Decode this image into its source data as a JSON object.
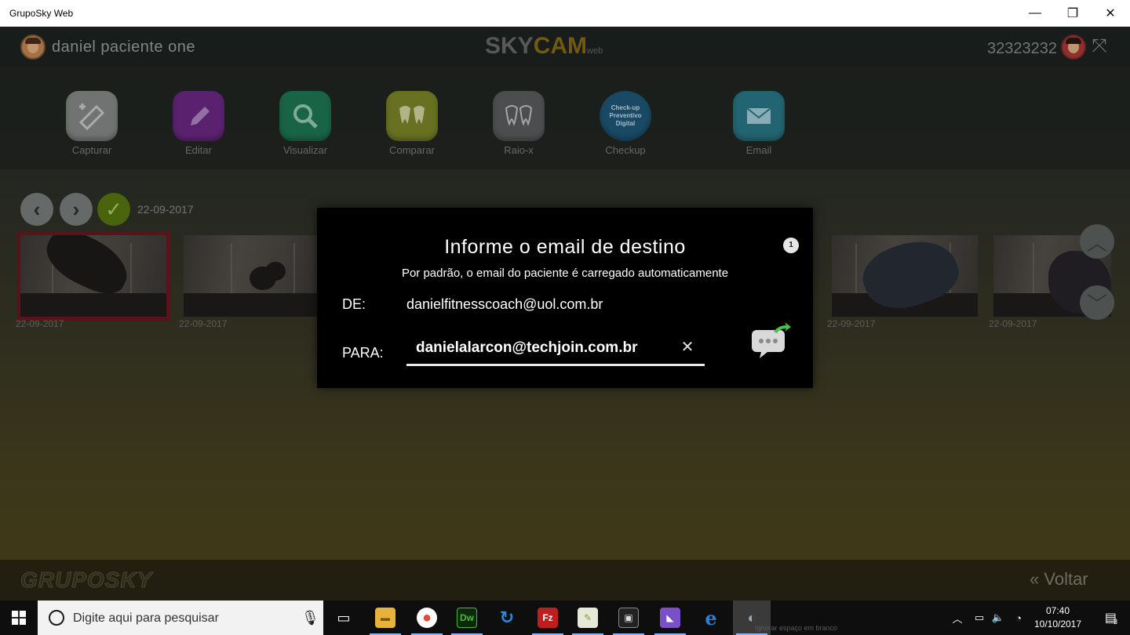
{
  "window": {
    "title": "GrupoSky Web",
    "controls": {
      "minimize": "—",
      "restore": "❐",
      "close": "✕"
    }
  },
  "header": {
    "patient_name": "daniel paciente one",
    "brand_sky": "SKY",
    "brand_cam": "CAM",
    "brand_web": "web",
    "patient_id": "32323232",
    "expand_glyph": "⤧"
  },
  "toolbar": {
    "items": [
      {
        "label": "Capturar",
        "icon": "camera-capture-icon",
        "color": "#8a8d8c"
      },
      {
        "label": "Editar",
        "icon": "pencil-icon",
        "color": "#6e2a87"
      },
      {
        "label": "Visualizar",
        "icon": "magnifier-icon",
        "color": "#1f7a57"
      },
      {
        "label": "Comparar",
        "icon": "teeth-icon",
        "color": "#7f8a2a"
      },
      {
        "label": "Raio-x",
        "icon": "xray-teeth-icon",
        "color": "#5d5f60"
      },
      {
        "label": "Checkup",
        "icon": "checkup-badge-icon",
        "color": "#1f5a7a",
        "badge_text": "Check-up Preventivo Digital"
      },
      {
        "label": "Email",
        "icon": "envelope-icon",
        "color": "#2a7a8a"
      }
    ]
  },
  "nav": {
    "prev_glyph": "‹",
    "next_glyph": "›",
    "check_glyph": "✓",
    "date": "22-09-2017"
  },
  "thumbnails": [
    {
      "date": "22-09-2017",
      "selected": true
    },
    {
      "date": "22-09-2017",
      "selected": false
    },
    {
      "date": "22-09-2017",
      "selected": false
    },
    {
      "date": "22-09-2017",
      "selected": false
    }
  ],
  "scroll": {
    "up_glyph": "︿",
    "down_glyph": "﹀"
  },
  "footer": {
    "logo": "GRUPOSKY",
    "back_label": "Voltar",
    "back_glyph": "«"
  },
  "modal": {
    "title": "Informe o email de destino",
    "subtitle": "Por padrão, o email do paciente é carregado automaticamente",
    "info_badge": "1",
    "from_label": "DE:",
    "from_value": "danielfitnesscoach@uol.com.br",
    "to_label": "PARA:",
    "to_value": "danielalarcon@techjoin.com.br",
    "clear_glyph": "✕"
  },
  "taskbar": {
    "search_placeholder": "Digite aqui para pesquisar",
    "apps": [
      {
        "name": "task-view",
        "glyph": "▭"
      },
      {
        "name": "file-explorer",
        "glyph": "▬",
        "color": "#e8b33a"
      },
      {
        "name": "chrome",
        "glyph": "●",
        "color": "#dd4b39"
      },
      {
        "name": "dreamweaver",
        "glyph": "Dw",
        "color": "#4cb83a"
      },
      {
        "name": "refresh-app",
        "glyph": "↻",
        "color": "#2a8ae0"
      },
      {
        "name": "filezilla",
        "glyph": "Fz",
        "color": "#bf1e1e"
      },
      {
        "name": "notepad",
        "glyph": "✎",
        "color": "#7aa640"
      },
      {
        "name": "terminal",
        "glyph": "▣",
        "color": "#555555"
      },
      {
        "name": "visual-studio",
        "glyph": "◣",
        "color": "#7b4fc6"
      },
      {
        "name": "edge",
        "glyph": "e",
        "color": "#2a7fd4"
      },
      {
        "name": "gruposky-web",
        "glyph": "◐",
        "color": "#9ab",
        "active": true
      }
    ],
    "ghost_text": "Ignorar espaço em branco",
    "clock_time": "07:40",
    "clock_date": "10/10/2017",
    "notifications_count": "3"
  }
}
